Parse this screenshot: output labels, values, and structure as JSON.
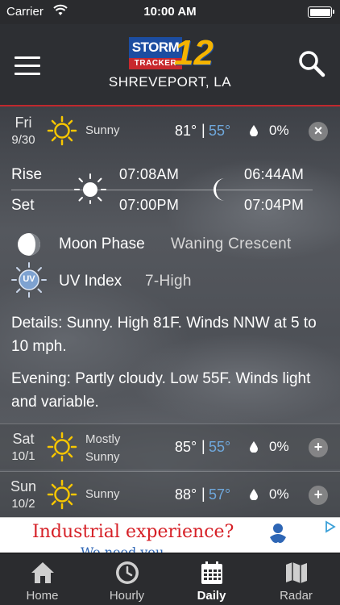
{
  "status_bar": {
    "carrier": "Carrier",
    "time": "10:00 AM"
  },
  "header": {
    "logo_storm": "STORM",
    "logo_tracker": "TRACKER",
    "logo_number": "12",
    "location": "SHREVEPORT, LA"
  },
  "today": {
    "day": "Fri",
    "date": "9/30",
    "condition": "Sunny",
    "high": "81°",
    "separator": "|",
    "low": "55°",
    "precip": "0%",
    "icon": "sun-icon",
    "toggle": "×"
  },
  "detail": {
    "rise_label": "Rise",
    "set_label": "Set",
    "sunrise": "07:08AM",
    "sunset": "07:00PM",
    "moonrise": "06:44AM",
    "moonset": "07:04PM",
    "moon_phase_label": "Moon Phase",
    "moon_phase_value": "Waning Crescent",
    "uv_label": "UV Index",
    "uv_value": "7-High",
    "uv_badge": "UV",
    "details_text": "Details: Sunny. High 81F. Winds NNW at 5 to 10 mph.",
    "evening_text": "Evening: Partly cloudy. Low 55F. Winds light and variable."
  },
  "forecast": [
    {
      "day": "Sat",
      "date": "10/1",
      "condition_line1": "Mostly",
      "condition_line2": "Sunny",
      "high": "85°",
      "separator": "|",
      "low": "55°",
      "precip": "0%",
      "toggle": "+"
    },
    {
      "day": "Sun",
      "date": "10/2",
      "condition_line1": "Sunny",
      "condition_line2": "",
      "high": "88°",
      "separator": "|",
      "low": "57°",
      "precip": "0%",
      "toggle": "+"
    }
  ],
  "ad": {
    "headline": "Industrial experience?",
    "subline": "We need you"
  },
  "tabs": [
    {
      "label": "Home",
      "icon": "home-icon"
    },
    {
      "label": "Hourly",
      "icon": "clock-icon"
    },
    {
      "label": "Daily",
      "icon": "calendar-icon",
      "active": true
    },
    {
      "label": "Radar",
      "icon": "map-icon"
    }
  ],
  "colors": {
    "accent_red": "#c0282d",
    "low_temp_blue": "#6fa8dc",
    "sun_yellow": "#f7c600"
  }
}
